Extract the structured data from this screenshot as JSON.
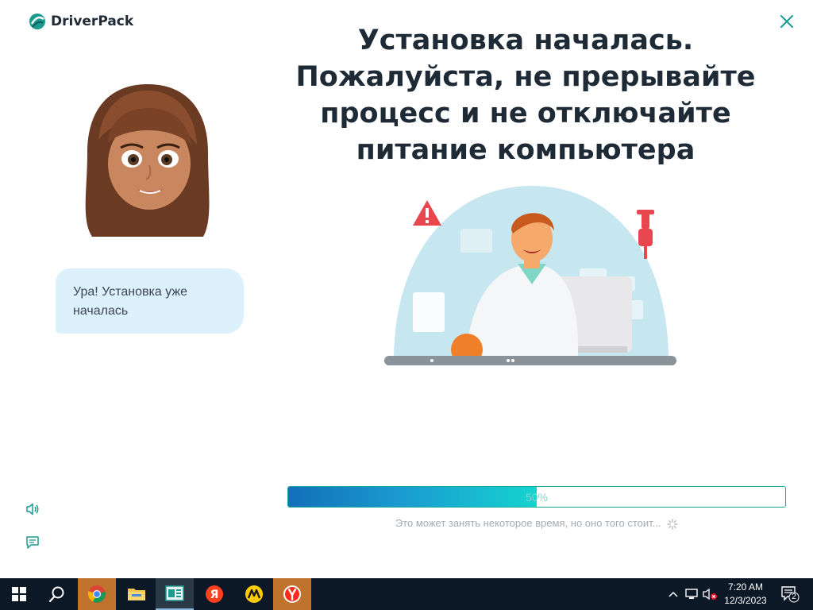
{
  "app": {
    "brand": "DriverPack",
    "title_lines": [
      "Установка началась.",
      "Пожалуйста, не прерывайте",
      "процесс и не отключайте",
      "питание компьютера"
    ],
    "bubble_lines": [
      "Ура! Установка уже",
      "началась"
    ],
    "progress": {
      "value": 0.5,
      "label": "50%"
    },
    "hint": "Это может занять некоторое время, но оно того стоит..."
  },
  "taskbar": {
    "apps": [
      "start",
      "search",
      "chrome",
      "file-explorer",
      "driverpack",
      "yandex",
      "yandex-market",
      "yandex-browser"
    ],
    "clock": {
      "time": "7:20 AM",
      "date": "12/3/2023"
    },
    "notifications": "2"
  },
  "colors": {
    "accent": "#19a89a",
    "bubble": "#dcf1fb",
    "title": "#1e2b36",
    "taskbar": "#0c1826",
    "alert_red": "#e8474f"
  }
}
